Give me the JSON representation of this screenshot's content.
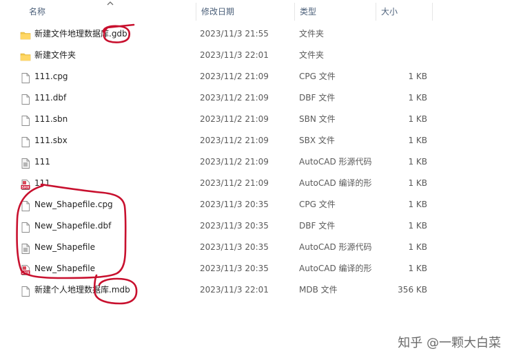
{
  "columns": {
    "name": "名称",
    "date": "修改日期",
    "type": "类型",
    "size": "大小"
  },
  "files": [
    {
      "name": "新建文件地理数据库.gdb",
      "date": "2023/11/3 21:55",
      "type": "文件夹",
      "size": "",
      "icon": "folder-icon"
    },
    {
      "name": "新建文件夹",
      "date": "2023/11/3 22:01",
      "type": "文件夹",
      "size": "",
      "icon": "folder-icon"
    },
    {
      "name": "111.cpg",
      "date": "2023/11/2 21:09",
      "type": "CPG 文件",
      "size": "1 KB",
      "icon": "document-icon"
    },
    {
      "name": "111.dbf",
      "date": "2023/11/2 21:09",
      "type": "DBF 文件",
      "size": "1 KB",
      "icon": "document-icon"
    },
    {
      "name": "111.sbn",
      "date": "2023/11/2 21:09",
      "type": "SBN 文件",
      "size": "1 KB",
      "icon": "document-icon"
    },
    {
      "name": "111.sbx",
      "date": "2023/11/2 21:09",
      "type": "SBX 文件",
      "size": "1 KB",
      "icon": "document-icon"
    },
    {
      "name": "111",
      "date": "2023/11/2 21:09",
      "type": "AutoCAD 形源代码",
      "size": "1 KB",
      "icon": "autocad-shape-source-icon"
    },
    {
      "name": "111",
      "date": "2023/11/2 21:09",
      "type": "AutoCAD 编译的形",
      "size": "1 KB",
      "icon": "shx-icon"
    },
    {
      "name": "New_Shapefile.cpg",
      "date": "2023/11/3 20:35",
      "type": "CPG 文件",
      "size": "1 KB",
      "icon": "document-icon"
    },
    {
      "name": "New_Shapefile.dbf",
      "date": "2023/11/3 20:35",
      "type": "DBF 文件",
      "size": "1 KB",
      "icon": "document-icon"
    },
    {
      "name": "New_Shapefile",
      "date": "2023/11/3 20:35",
      "type": "AutoCAD 形源代码",
      "size": "1 KB",
      "icon": "autocad-shape-source-icon"
    },
    {
      "name": "New_Shapefile",
      "date": "2023/11/3 20:35",
      "type": "AutoCAD 编译的形",
      "size": "1 KB",
      "icon": "shx-icon"
    },
    {
      "name": "新建个人地理数据库.mdb",
      "date": "2023/11/3 22:01",
      "type": "MDB 文件",
      "size": "356 KB",
      "icon": "document-icon"
    }
  ],
  "watermark": "知乎 @一颗大白菜",
  "colors": {
    "header_text": "#4c607a",
    "folder": "#f2c94c",
    "annotation": "#c8102e"
  }
}
